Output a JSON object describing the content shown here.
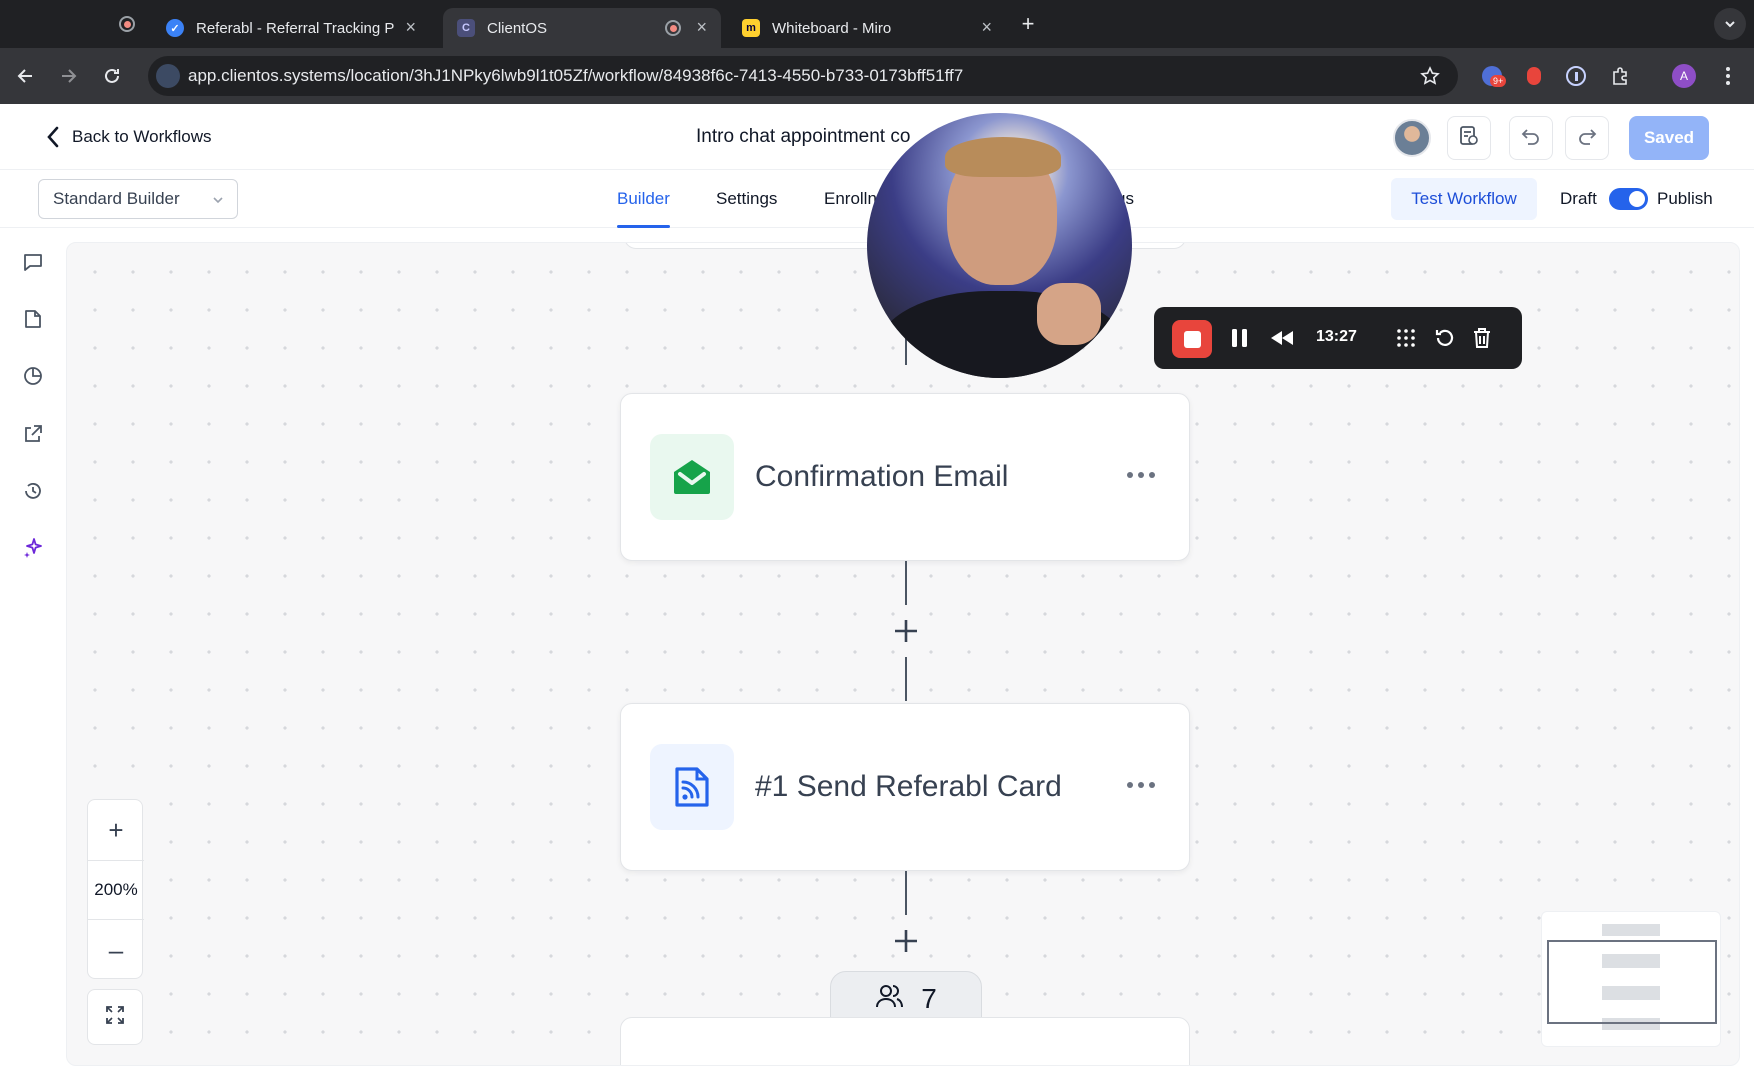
{
  "browser": {
    "tabs": [
      {
        "title": "Referabl - Referral Tracking P",
        "favicon": "referabl-icon",
        "recording": true
      },
      {
        "title": "ClientOS",
        "favicon": "clientos-icon",
        "active": true,
        "recording": true
      },
      {
        "title": "Whiteboard - Miro",
        "favicon": "miro-icon"
      }
    ],
    "new_tab": "+",
    "url": "app.clientos.systems/location/3hJ1NPky6lwb9l1t05Zf/workflow/84938f6c-7413-4550-b733-0173bff51ff7",
    "extension_badge": "9+",
    "profile_initial": "A"
  },
  "header": {
    "back_label": "Back to Workflows",
    "workflow_title": "Intro chat appointment co",
    "saved_label": "Saved"
  },
  "toolbar": {
    "builder_select": "Standard Builder",
    "tabs": [
      "Builder",
      "Settings",
      "Enrolln",
      "gs"
    ],
    "active_tab": "Builder",
    "test_label": "Test Workflow",
    "draft_label": "Draft",
    "publish_label": "Publish",
    "publish_toggle_on": true
  },
  "canvas": {
    "nodes": [
      {
        "label": "Confirmation Email",
        "icon": "envelope-open-icon",
        "color": "#16a34a"
      },
      {
        "label": "#1 Send Referabl Card",
        "icon": "rss-document-icon",
        "color": "#2563eb"
      }
    ],
    "enrolled_count": "7",
    "zoom": {
      "in": "+",
      "level": "200%",
      "out": "–"
    }
  },
  "recorder": {
    "time": "13:27"
  },
  "colors": {
    "accent": "#2563eb",
    "saved_button": "#93b4f8",
    "record_red": "#e8453c"
  }
}
